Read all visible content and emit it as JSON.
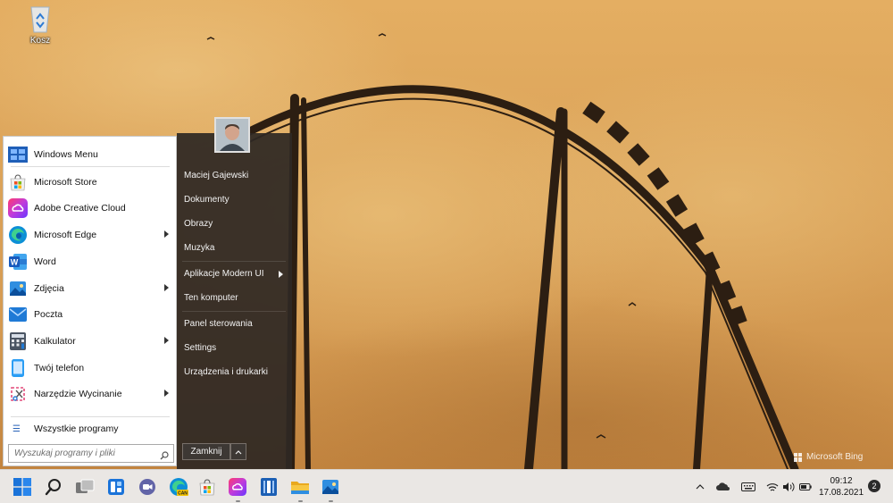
{
  "desktop": {
    "recycle_bin_label": "Kosz",
    "watermark": "Microsoft Bing"
  },
  "start_menu": {
    "pinned": [
      {
        "label": "Windows Menu",
        "icon": "windows-menu-icon",
        "submenu": false
      },
      {
        "label": "Microsoft Store",
        "icon": "store-icon",
        "submenu": false
      },
      {
        "label": "Adobe Creative Cloud",
        "icon": "creative-cloud-icon",
        "submenu": false
      },
      {
        "label": "Microsoft Edge",
        "icon": "edge-icon",
        "submenu": true
      },
      {
        "label": "Word",
        "icon": "word-icon",
        "submenu": false
      },
      {
        "label": "Zdjęcia",
        "icon": "photos-icon",
        "submenu": true
      },
      {
        "label": "Poczta",
        "icon": "mail-icon",
        "submenu": false
      },
      {
        "label": "Kalkulator",
        "icon": "calculator-icon",
        "submenu": true
      },
      {
        "label": "Twój telefon",
        "icon": "phone-icon",
        "submenu": false
      },
      {
        "label": "Narzędzie Wycinanie",
        "icon": "snipping-tool-icon",
        "submenu": true
      }
    ],
    "all_programs": "Wszystkie programy",
    "search_placeholder": "Wyszukaj programy i pliki",
    "right_items": [
      {
        "label": "Maciej Gajewski",
        "submenu": false
      },
      {
        "label": "Dokumenty",
        "submenu": false
      },
      {
        "label": "Obrazy",
        "submenu": false
      },
      {
        "label": "Muzyka",
        "submenu": false
      },
      {
        "label": "Aplikacje Modern UI",
        "submenu": true
      },
      {
        "label": "Ten komputer",
        "submenu": false
      },
      {
        "label": "Panel sterowania",
        "submenu": false
      },
      {
        "label": "Settings",
        "submenu": false
      },
      {
        "label": "Urządzenia i drukarki",
        "submenu": false
      }
    ],
    "shutdown_label": "Zamknij"
  },
  "taskbar": {
    "apps": [
      "start-icon",
      "search-icon",
      "task-view-icon",
      "widgets-icon",
      "teams-chat-icon",
      "edge-can-icon",
      "store-icon",
      "creative-cloud-icon",
      "office-icon",
      "file-explorer-icon",
      "photos-icon"
    ],
    "time": "09:12",
    "date": "17.08.2021",
    "notification_count": "2"
  }
}
